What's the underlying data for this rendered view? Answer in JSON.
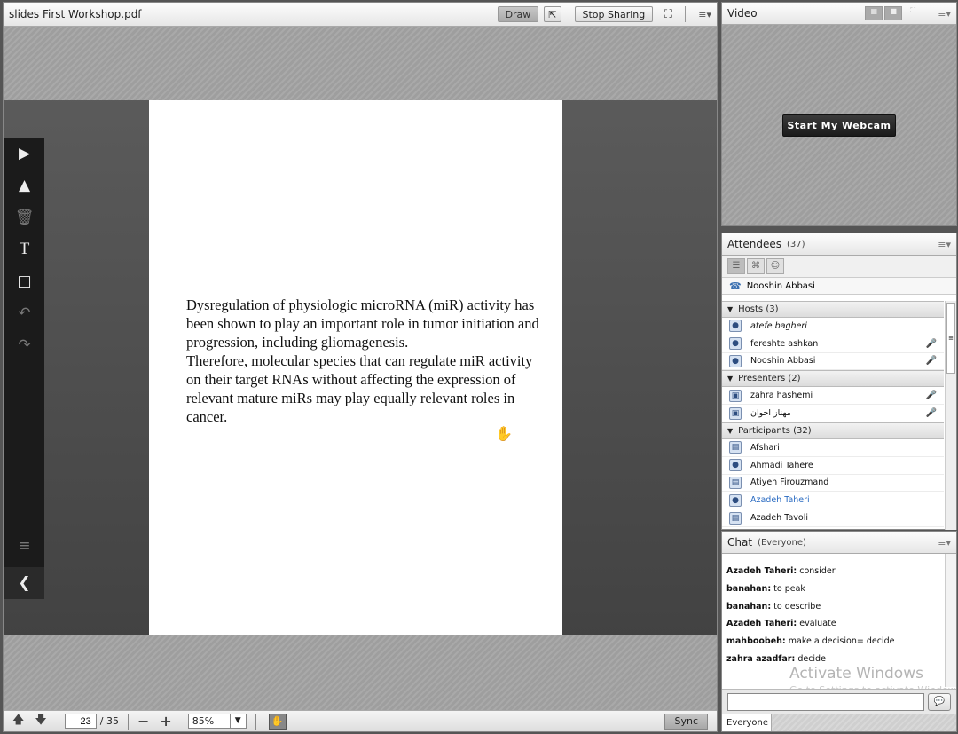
{
  "share": {
    "title": "slides First Workshop.pdf",
    "draw_label": "Draw",
    "stop_sharing_label": "Stop Sharing",
    "menu_glyph": "≡▾",
    "slide_paragraphs": [
      "Dysregulation of physiologic microRNA (miR) activity has been shown to play an important role in tumor initiation and progression, including gliomagenesis.",
      "Therefore, molecular species that can regulate miR activity on their target RNAs without affecting the expression of relevant mature miRs may play equally relevant roles in cancer."
    ],
    "footer": {
      "page_value": "23",
      "page_total": "/ 35",
      "zoom_value": "85%",
      "sync_label": "Sync"
    }
  },
  "video": {
    "title": "Video",
    "start_webcam_label": "Start My Webcam",
    "menu_glyph": "≡▾"
  },
  "attendees": {
    "title": "Attendees",
    "count": "(37)",
    "menu_glyph": "≡▾",
    "active_speaker": "Nooshin Abbasi",
    "groups": {
      "hosts": {
        "label": "Hosts (3)"
      },
      "presenters": {
        "label": "Presenters (2)"
      },
      "participants": {
        "label": "Participants (32)"
      }
    },
    "hosts": [
      "atefe bagheri",
      "fereshte ashkan",
      "Nooshin Abbasi"
    ],
    "presenters": [
      "zahra hashemi",
      "مهناز اخوان"
    ],
    "participants": [
      "Afshari",
      "Ahmadi Tahere",
      "Atiyeh Firouzmand",
      "Azadeh Taheri",
      "Azadeh Tavoli"
    ]
  },
  "chat": {
    "title": "Chat",
    "scope": "(Everyone)",
    "menu_glyph": "≡▾",
    "messages": [
      {
        "sender": "Azadeh Taheri:",
        "text": " consider"
      },
      {
        "sender": "banahan:",
        "text": " to peak"
      },
      {
        "sender": "banahan:",
        "text": " to describe"
      },
      {
        "sender": "Azadeh Taheri:",
        "text": " evaluate"
      },
      {
        "sender": "mahboobeh:",
        "text": " make a decision= decide"
      },
      {
        "sender": "zahra azadfar:",
        "text": " decide"
      }
    ],
    "watermark_title": "Activate Windows",
    "watermark_sub": "Go to Settings to activate Windows.",
    "tab_label": "Everyone"
  }
}
